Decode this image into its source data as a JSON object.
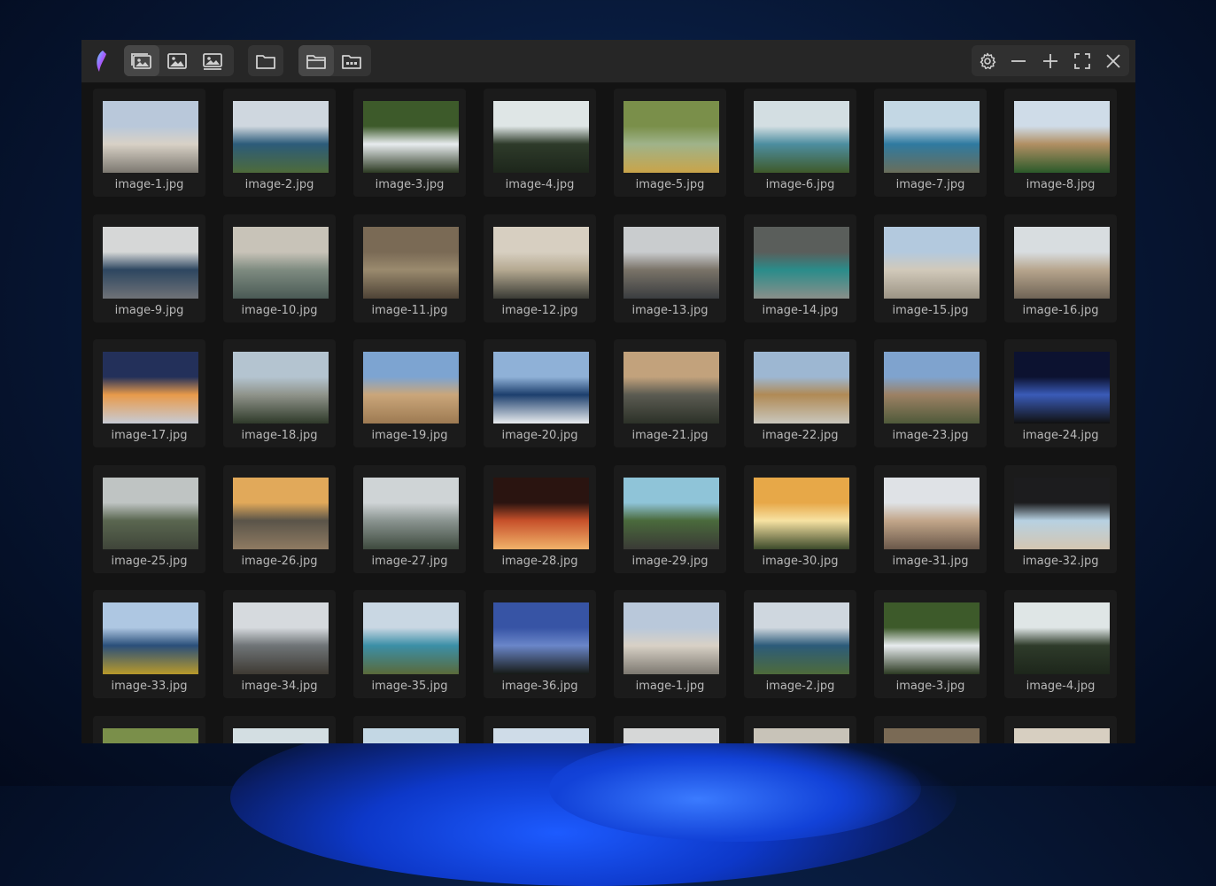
{
  "toolbar": {
    "view_buttons": [
      {
        "icon": "photo-grid-view-icon",
        "active": true
      },
      {
        "icon": "photo-single-icon",
        "active": false
      },
      {
        "icon": "photo-fit-icon",
        "active": false
      }
    ],
    "folder_button": {
      "icon": "folder-icon"
    },
    "folder_view_buttons": [
      {
        "icon": "folder-open-icon",
        "active": true
      },
      {
        "icon": "folder-thumbnails-icon",
        "active": false
      }
    ],
    "window_buttons": [
      "settings-gear-icon",
      "minimize-icon",
      "zoom-plus-icon",
      "fullscreen-icon",
      "close-icon"
    ]
  },
  "gallery": {
    "items": [
      {
        "filename": "image-1.jpg",
        "palette": [
          "#b9c8da",
          "#d8d1c6",
          "#7c7870"
        ]
      },
      {
        "filename": "image-2.jpg",
        "palette": [
          "#cfd7df",
          "#2c5b7a",
          "#4e6b3a"
        ]
      },
      {
        "filename": "image-3.jpg",
        "palette": [
          "#3d5a2a",
          "#e8ecef",
          "#2c3a22"
        ]
      },
      {
        "filename": "image-4.jpg",
        "palette": [
          "#dfe6e6",
          "#2e3b2a",
          "#1d261b"
        ]
      },
      {
        "filename": "image-5.jpg",
        "palette": [
          "#7a8f4a",
          "#9fb38a",
          "#c9a449"
        ]
      },
      {
        "filename": "image-6.jpg",
        "palette": [
          "#d3dee2",
          "#4d8ea0",
          "#3f5a2a"
        ]
      },
      {
        "filename": "image-7.jpg",
        "palette": [
          "#c3d7e4",
          "#2f7aa0",
          "#6a6e5a"
        ]
      },
      {
        "filename": "image-8.jpg",
        "palette": [
          "#cfdce8",
          "#b18f63",
          "#2b5a2a"
        ]
      },
      {
        "filename": "image-9.jpg",
        "palette": [
          "#d6d7d7",
          "#2d4660",
          "#6f7277"
        ]
      },
      {
        "filename": "image-10.jpg",
        "palette": [
          "#c8c3b8",
          "#7e8b80",
          "#4a5a55"
        ]
      },
      {
        "filename": "image-11.jpg",
        "palette": [
          "#7a6a55",
          "#9a8a6e",
          "#4e4336"
        ]
      },
      {
        "filename": "image-12.jpg",
        "palette": [
          "#d7cfc1",
          "#b5a991",
          "#3a3b35"
        ]
      },
      {
        "filename": "image-13.jpg",
        "palette": [
          "#c9ccce",
          "#7a7368",
          "#3a3d40"
        ]
      },
      {
        "filename": "image-14.jpg",
        "palette": [
          "#5a5e5b",
          "#2a8c8a",
          "#8a8f8a"
        ]
      },
      {
        "filename": "image-15.jpg",
        "palette": [
          "#b3c9de",
          "#d1c9ba",
          "#9c9485"
        ]
      },
      {
        "filename": "image-16.jpg",
        "palette": [
          "#d8dde0",
          "#b7a58d",
          "#6f6456"
        ]
      },
      {
        "filename": "image-17.jpg",
        "palette": [
          "#23305a",
          "#e89a4a",
          "#c7cbd5"
        ]
      },
      {
        "filename": "image-18.jpg",
        "palette": [
          "#b4c4d0",
          "#8f938a",
          "#2f3a2a"
        ]
      },
      {
        "filename": "image-19.jpg",
        "palette": [
          "#7da4d1",
          "#caa67a",
          "#9d7a52"
        ]
      },
      {
        "filename": "image-20.jpg",
        "palette": [
          "#8fb1d7",
          "#1d3f6d",
          "#e9ecef"
        ]
      },
      {
        "filename": "image-21.jpg",
        "palette": [
          "#c2a27c",
          "#5b5b52",
          "#2c3128"
        ]
      },
      {
        "filename": "image-22.jpg",
        "palette": [
          "#9db7d2",
          "#b08a55",
          "#c9c7bd"
        ]
      },
      {
        "filename": "image-23.jpg",
        "palette": [
          "#7fa3ce",
          "#9c8164",
          "#4f5a3a"
        ]
      },
      {
        "filename": "image-24.jpg",
        "palette": [
          "#0c1230",
          "#3a5bb8",
          "#101010"
        ]
      },
      {
        "filename": "image-25.jpg",
        "palette": [
          "#bfc4c3",
          "#5a6650",
          "#3f4539"
        ]
      },
      {
        "filename": "image-26.jpg",
        "palette": [
          "#e1a95a",
          "#5a5449",
          "#8f7b62"
        ]
      },
      {
        "filename": "image-27.jpg",
        "palette": [
          "#cfd4d6",
          "#8a9490",
          "#3e4a3e"
        ]
      },
      {
        "filename": "image-28.jpg",
        "palette": [
          "#2a1410",
          "#c6502a",
          "#f2b36a"
        ]
      },
      {
        "filename": "image-29.jpg",
        "palette": [
          "#8fc4d8",
          "#4a6a3c",
          "#3a3a36"
        ]
      },
      {
        "filename": "image-30.jpg",
        "palette": [
          "#e7a848",
          "#f7e2a2",
          "#3c4a2a"
        ]
      },
      {
        "filename": "image-31.jpg",
        "palette": [
          "#dfe2e6",
          "#c2a68a",
          "#6a584a"
        ]
      },
      {
        "filename": "image-32.jpg",
        "palette": [
          "#1c1c1e",
          "#b7d1e2",
          "#d4c6b1"
        ]
      },
      {
        "filename": "image-33.jpg",
        "palette": [
          "#aec7e2",
          "#2a4f7a",
          "#b89a2a"
        ]
      },
      {
        "filename": "image-34.jpg",
        "palette": [
          "#d6dade",
          "#6f7477",
          "#3e3a33"
        ]
      },
      {
        "filename": "image-35.jpg",
        "palette": [
          "#c9d7e3",
          "#3b8fa7",
          "#5a6a3a"
        ]
      },
      {
        "filename": "image-36.jpg",
        "palette": [
          "#3754a5",
          "#6a86c9",
          "#161a16"
        ]
      },
      {
        "filename": "image-1.jpg",
        "palette": [
          "#b9c8da",
          "#d8d1c6",
          "#7c7870"
        ]
      },
      {
        "filename": "image-2.jpg",
        "palette": [
          "#cfd7df",
          "#2c5b7a",
          "#4e6b3a"
        ]
      },
      {
        "filename": "image-3.jpg",
        "palette": [
          "#3d5a2a",
          "#e8ecef",
          "#2c3a22"
        ]
      },
      {
        "filename": "image-4.jpg",
        "palette": [
          "#dfe6e6",
          "#2e3b2a",
          "#1d261b"
        ]
      },
      {
        "filename": "",
        "palette": [
          "#7a8f4a",
          "#9fb38a",
          "#c9a449"
        ]
      },
      {
        "filename": "",
        "palette": [
          "#d3dee2",
          "#4d8ea0",
          "#3f5a2a"
        ]
      },
      {
        "filename": "",
        "palette": [
          "#c3d7e4",
          "#2f7aa0",
          "#6a6e5a"
        ]
      },
      {
        "filename": "",
        "palette": [
          "#cfdce8",
          "#b18f63",
          "#2b5a2a"
        ]
      },
      {
        "filename": "",
        "palette": [
          "#d6d7d7",
          "#2d4660",
          "#6f7277"
        ]
      },
      {
        "filename": "",
        "palette": [
          "#c8c3b8",
          "#7e8b80",
          "#4a5a55"
        ]
      },
      {
        "filename": "",
        "palette": [
          "#7a6a55",
          "#9a8a6e",
          "#4e4336"
        ]
      },
      {
        "filename": "",
        "palette": [
          "#d7cfc1",
          "#b5a991",
          "#3a3b35"
        ]
      }
    ]
  }
}
